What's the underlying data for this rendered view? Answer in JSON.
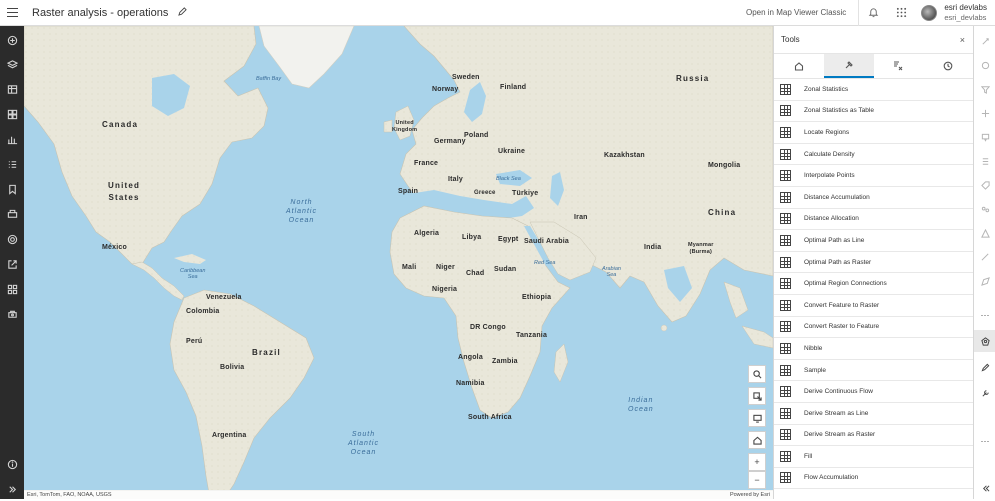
{
  "header": {
    "title": "Raster analysis - operations",
    "open_classic": "Open in Map Viewer Classic",
    "user_name": "esri devlabs",
    "user_handle": "esri_devlabs"
  },
  "left_bar": {
    "icons": [
      "add-layer-icon",
      "layers-icon",
      "tables-icon",
      "basemap-icon",
      "charts-icon",
      "legend-icon",
      "bookmarks-icon",
      "print-icon",
      "map-properties-icon",
      "share-icon",
      "create-app-icon",
      "media-layer-icon",
      "help-icon",
      "expand-icon"
    ]
  },
  "map": {
    "labels": {
      "canada": "Canada",
      "united_states": "United\nStates",
      "mexico": "México",
      "russia": "Russia",
      "sweden": "Sweden",
      "norway": "Norway",
      "finland": "Finland",
      "united_kingdom": "United\nKingdom",
      "poland": "Poland",
      "germany": "Germany",
      "ukraine": "Ukraine",
      "france": "France",
      "kazakhstan": "Kazakhstan",
      "mongolia": "Mongolia",
      "spain": "Spain",
      "italy": "Italy",
      "greece": "Greece",
      "turkiye": "Türkiye",
      "china": "China",
      "iran": "Iran",
      "algeria": "Algeria",
      "libya": "Libya",
      "egypt": "Egypt",
      "saudi_arabia": "Saudi Arabia",
      "india": "India",
      "myanmar": "Myanmar\n(Burma)",
      "mali": "Mali",
      "niger": "Niger",
      "chad": "Chad",
      "sudan": "Sudan",
      "nigeria": "Nigeria",
      "ethiopia": "Ethiopia",
      "venezuela": "Venezuela",
      "colombia": "Colombia",
      "peru": "Perú",
      "brazil": "Brazil",
      "bolivia": "Bolivia",
      "argentina": "Argentina",
      "dr_congo": "DR Congo",
      "tanzania": "Tanzania",
      "angola": "Angola",
      "zambia": "Zambia",
      "namibia": "Namibia",
      "south_africa": "South Africa"
    },
    "oceans": {
      "north_atlantic": "North\nAtlantic\nOcean",
      "south_atlantic": "South\nAtlantic\nOcean",
      "indian": "Indian\nOcean"
    },
    "seas": {
      "caribbean": "Caribbean\nSea",
      "arabian": "Arabian\nSea",
      "black": "Black Sea",
      "red": "Red Sea",
      "baffin": "Baffin Bay"
    },
    "attribution": "Esri, TomTom, FAO, NOAA, USGS",
    "powered_by": "Powered by Esri"
  },
  "tools_panel": {
    "title": "Tools",
    "close_glyph": "×",
    "tabs": [
      "home-icon",
      "tools-icon",
      "raster-functions-icon",
      "history-icon"
    ],
    "active_tab": 1,
    "items": [
      "Zonal Statistics",
      "Zonal Statistics as Table",
      "Locate Regions",
      "Calculate Density",
      "Interpolate Points",
      "Distance Accumulation",
      "Distance Allocation",
      "Optimal Path as Line",
      "Optimal Path as Raster",
      "Optimal Region Connections",
      "Convert Feature to Raster",
      "Convert Raster to Feature",
      "Nibble",
      "Sample",
      "Derive Continuous Flow",
      "Derive Stream as Line",
      "Derive Stream as Raster",
      "Fill",
      "Flow Accumulation"
    ]
  },
  "map_controls": {
    "zoom_in": "+",
    "zoom_out": "−"
  },
  "colors": {
    "water": "#a9d3ea",
    "land": "#eceae0",
    "left_bar": "#2b2b2b",
    "accent": "#007ac2"
  }
}
